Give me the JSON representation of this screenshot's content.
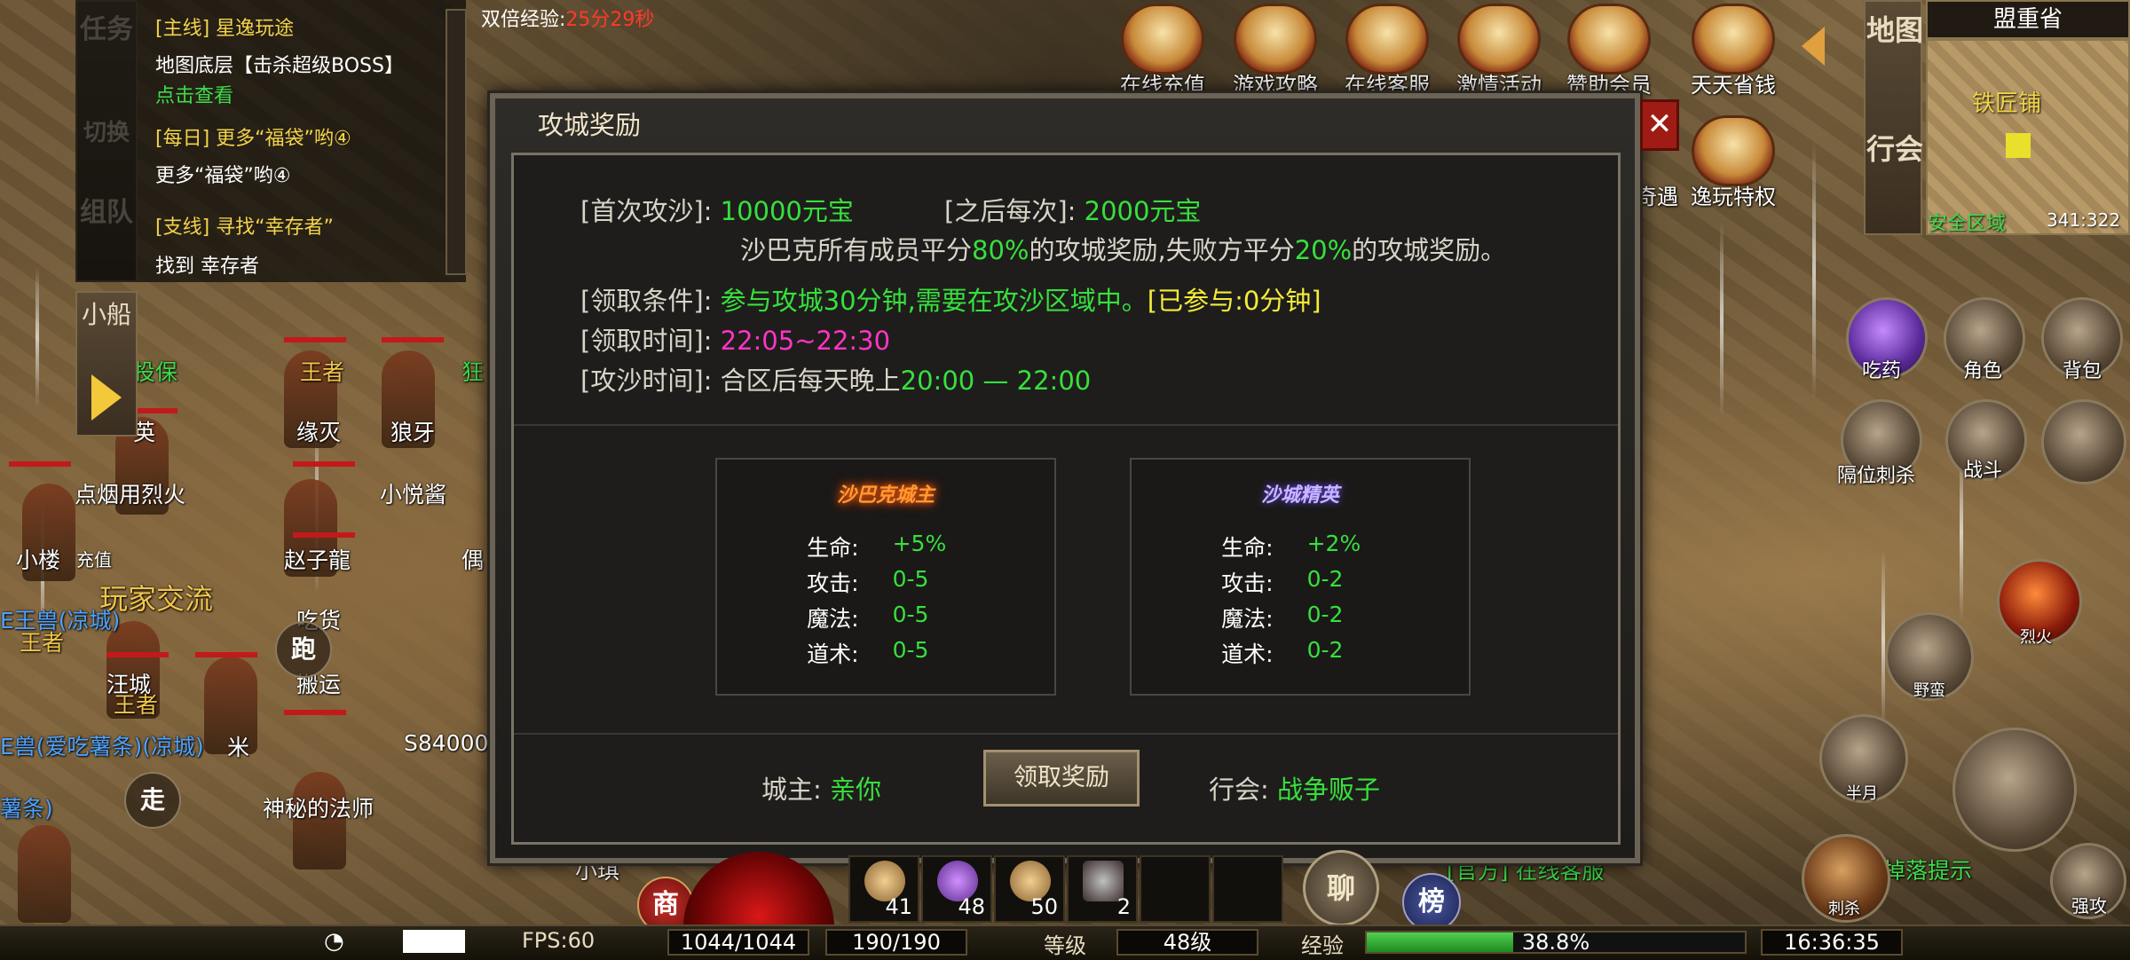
{
  "status": {
    "double_exp_label": "双倍经验:",
    "double_exp_time": "25分29秒"
  },
  "quest_panel": {
    "tabs": [
      "任务",
      "切换",
      "组队"
    ],
    "small_boat_tab": "小船",
    "quests": [
      {
        "header": "[主线] 星逸玩途",
        "body": "地图底层【击杀超级BOSS】",
        "link": "点击查看"
      },
      {
        "header": "[每日] 更多“福袋”哟④",
        "body": "更多“福袋”哟④",
        "link": ""
      },
      {
        "header": "[支线] 寻找“幸存者”",
        "body": "找到 幸存者",
        "link": ""
      }
    ]
  },
  "top_icons": [
    {
      "label": "在线充值",
      "icon": "recharge-icon"
    },
    {
      "label": "游戏攻略",
      "icon": "guide-icon"
    },
    {
      "label": "在线客服",
      "icon": "service-icon"
    },
    {
      "label": "激情活动",
      "icon": "activity-icon"
    },
    {
      "label": "赞助会员",
      "icon": "vip-icon"
    },
    {
      "label": "天天省钱",
      "icon": "saving-icon"
    }
  ],
  "side_icons": [
    {
      "label": "奇遇",
      "icon": "adventure-icon"
    },
    {
      "label": "逸玩特权",
      "icon": "privilege-icon"
    }
  ],
  "minimap": {
    "tabs": [
      "地图",
      "行会"
    ],
    "region": "盟重省",
    "map_name": "铁匠铺",
    "zone": "安全区域",
    "coords": "341:322"
  },
  "right_buttons": [
    {
      "label": "吃药",
      "icon": "potion-icon"
    },
    {
      "label": "角色",
      "icon": "character-icon"
    },
    {
      "label": "背包",
      "icon": "bag-icon"
    },
    {
      "label": "隔位刺杀",
      "icon": "stab-icon"
    },
    {
      "label": "战斗",
      "icon": "battle-icon"
    },
    {
      "label": "烈火",
      "icon": "fire-icon"
    },
    {
      "label": "野蛮",
      "icon": "charge-icon"
    },
    {
      "label": "半月",
      "icon": "halfmoon-icon"
    },
    {
      "label": "刺杀",
      "icon": "sword-icon"
    },
    {
      "label": "强攻",
      "icon": "strong-attack-icon"
    }
  ],
  "dialog": {
    "title": "攻城奖励",
    "close": "✕",
    "first_label": "[首次攻沙]:",
    "first_value": "10000元宝",
    "after_label": "[之后每次]:",
    "after_value": "2000元宝",
    "share_1": "沙巴克所有成员平分",
    "share_pct_win": "80%",
    "share_2": "的攻城奖励,失败方平分",
    "share_pct_lose": "20%",
    "share_3": "的攻城奖励。",
    "cond_label": "[领取条件]:",
    "cond_value": "参与攻城30分钟,需要在攻沙区域中。",
    "cond_status": "[已参与:0分钟]",
    "time_label": "[领取时间]:",
    "time_value": "22:05~22:30",
    "siege_label": "[攻沙时间]:",
    "siege_text": "合区后每天晚上",
    "siege_value": "20:00 — 22:00",
    "cards": [
      {
        "title": "沙巴克城主",
        "color": "#ff9a30",
        "stats": [
          {
            "k": "生命:",
            "v": "+5%"
          },
          {
            "k": "攻击:",
            "v": "0-5"
          },
          {
            "k": "魔法:",
            "v": "0-5"
          },
          {
            "k": "道术:",
            "v": "0-5"
          }
        ]
      },
      {
        "title": "沙城精英",
        "color": "#b9a6ff",
        "stats": [
          {
            "k": "生命:",
            "v": "+2%"
          },
          {
            "k": "攻击:",
            "v": "0-2"
          },
          {
            "k": "魔法:",
            "v": "0-2"
          },
          {
            "k": "道术:",
            "v": "0-2"
          }
        ]
      }
    ],
    "owner_label": "城主:",
    "owner_value": "亲你",
    "claim_button": "领取奖励",
    "guild_label": "行会:",
    "guild_value": "战争贩子"
  },
  "world_names": [
    "投保",
    "英",
    "点烟用烈火",
    "缘灭",
    "狼牙",
    "小悦酱",
    "小楼",
    "充值",
    "赵子龍",
    "偶",
    "玩家交流",
    "吃货",
    "搬运",
    "汪城",
    "米",
    "S84000",
    "神秘的法师",
    "小琪",
    "王者",
    "王者",
    "王者",
    "狂",
    "[官方] 在线客服",
    "掉落提示"
  ],
  "world_buttons": {
    "run": "跑",
    "walk": "走",
    "shop": "商",
    "chat": "聊",
    "rank": "榜"
  },
  "items": [
    {
      "count": "41",
      "icon": "scroll-icon"
    },
    {
      "count": "48",
      "icon": "purple-scroll-icon"
    },
    {
      "count": "50",
      "icon": "scroll-icon"
    },
    {
      "count": "2",
      "icon": "potion-icon"
    }
  ],
  "hud": {
    "fps": "FPS:60",
    "hp": "1044/1044",
    "mp": "190/190",
    "level_label": "等级",
    "level": "48级",
    "exp_label": "经验",
    "exp_value": "38.8%",
    "exp_fraction": 0.388,
    "clock": "16:36:35"
  }
}
